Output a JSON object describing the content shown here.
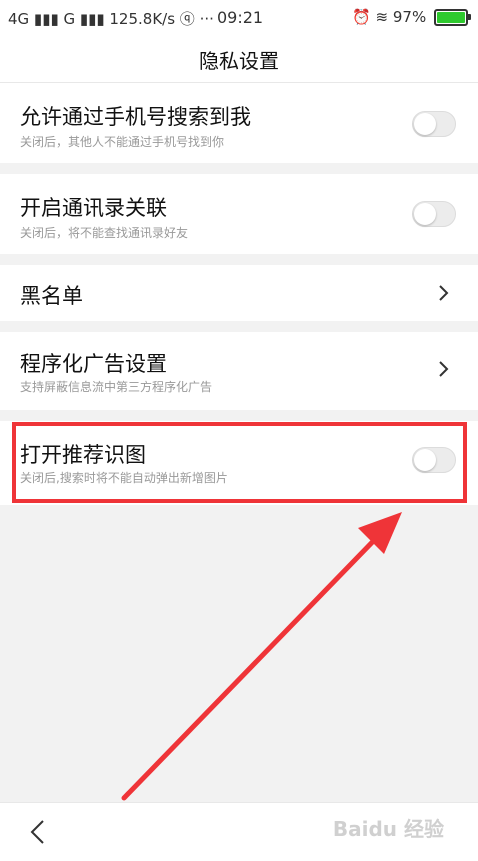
{
  "status_bar": {
    "left": "4G ▮▮▮ G ▮▮▮ 125.8K/s ⓠ ···",
    "time": "09:21",
    "battery_text": "97%"
  },
  "header": {
    "title": "隐私设置"
  },
  "settings": [
    {
      "title": "允许通过手机号搜索到我",
      "subtitle": "关闭后，其他人不能通过手机号找到你",
      "control": "toggle",
      "on": false
    },
    {
      "title": "开启通讯录关联",
      "subtitle": "关闭后，将不能查找通讯录好友",
      "control": "toggle",
      "on": false
    },
    {
      "title": "黑名单",
      "control": "chevron"
    },
    {
      "title": "程序化广告设置",
      "subtitle": "支持屏蔽信息流中第三方程序化广告",
      "control": "chevron"
    },
    {
      "title": "打开推荐识图",
      "subtitle": "关闭后,搜索时将不能自动弹出新增图片",
      "control": "toggle",
      "on": false
    }
  ],
  "annotation": {
    "color": "#ef3438"
  },
  "watermark": "Baidu 经验",
  "colors": {
    "toggle_off": "#ececec",
    "highlight": "#ef3438",
    "battery": "#2ec92e"
  }
}
